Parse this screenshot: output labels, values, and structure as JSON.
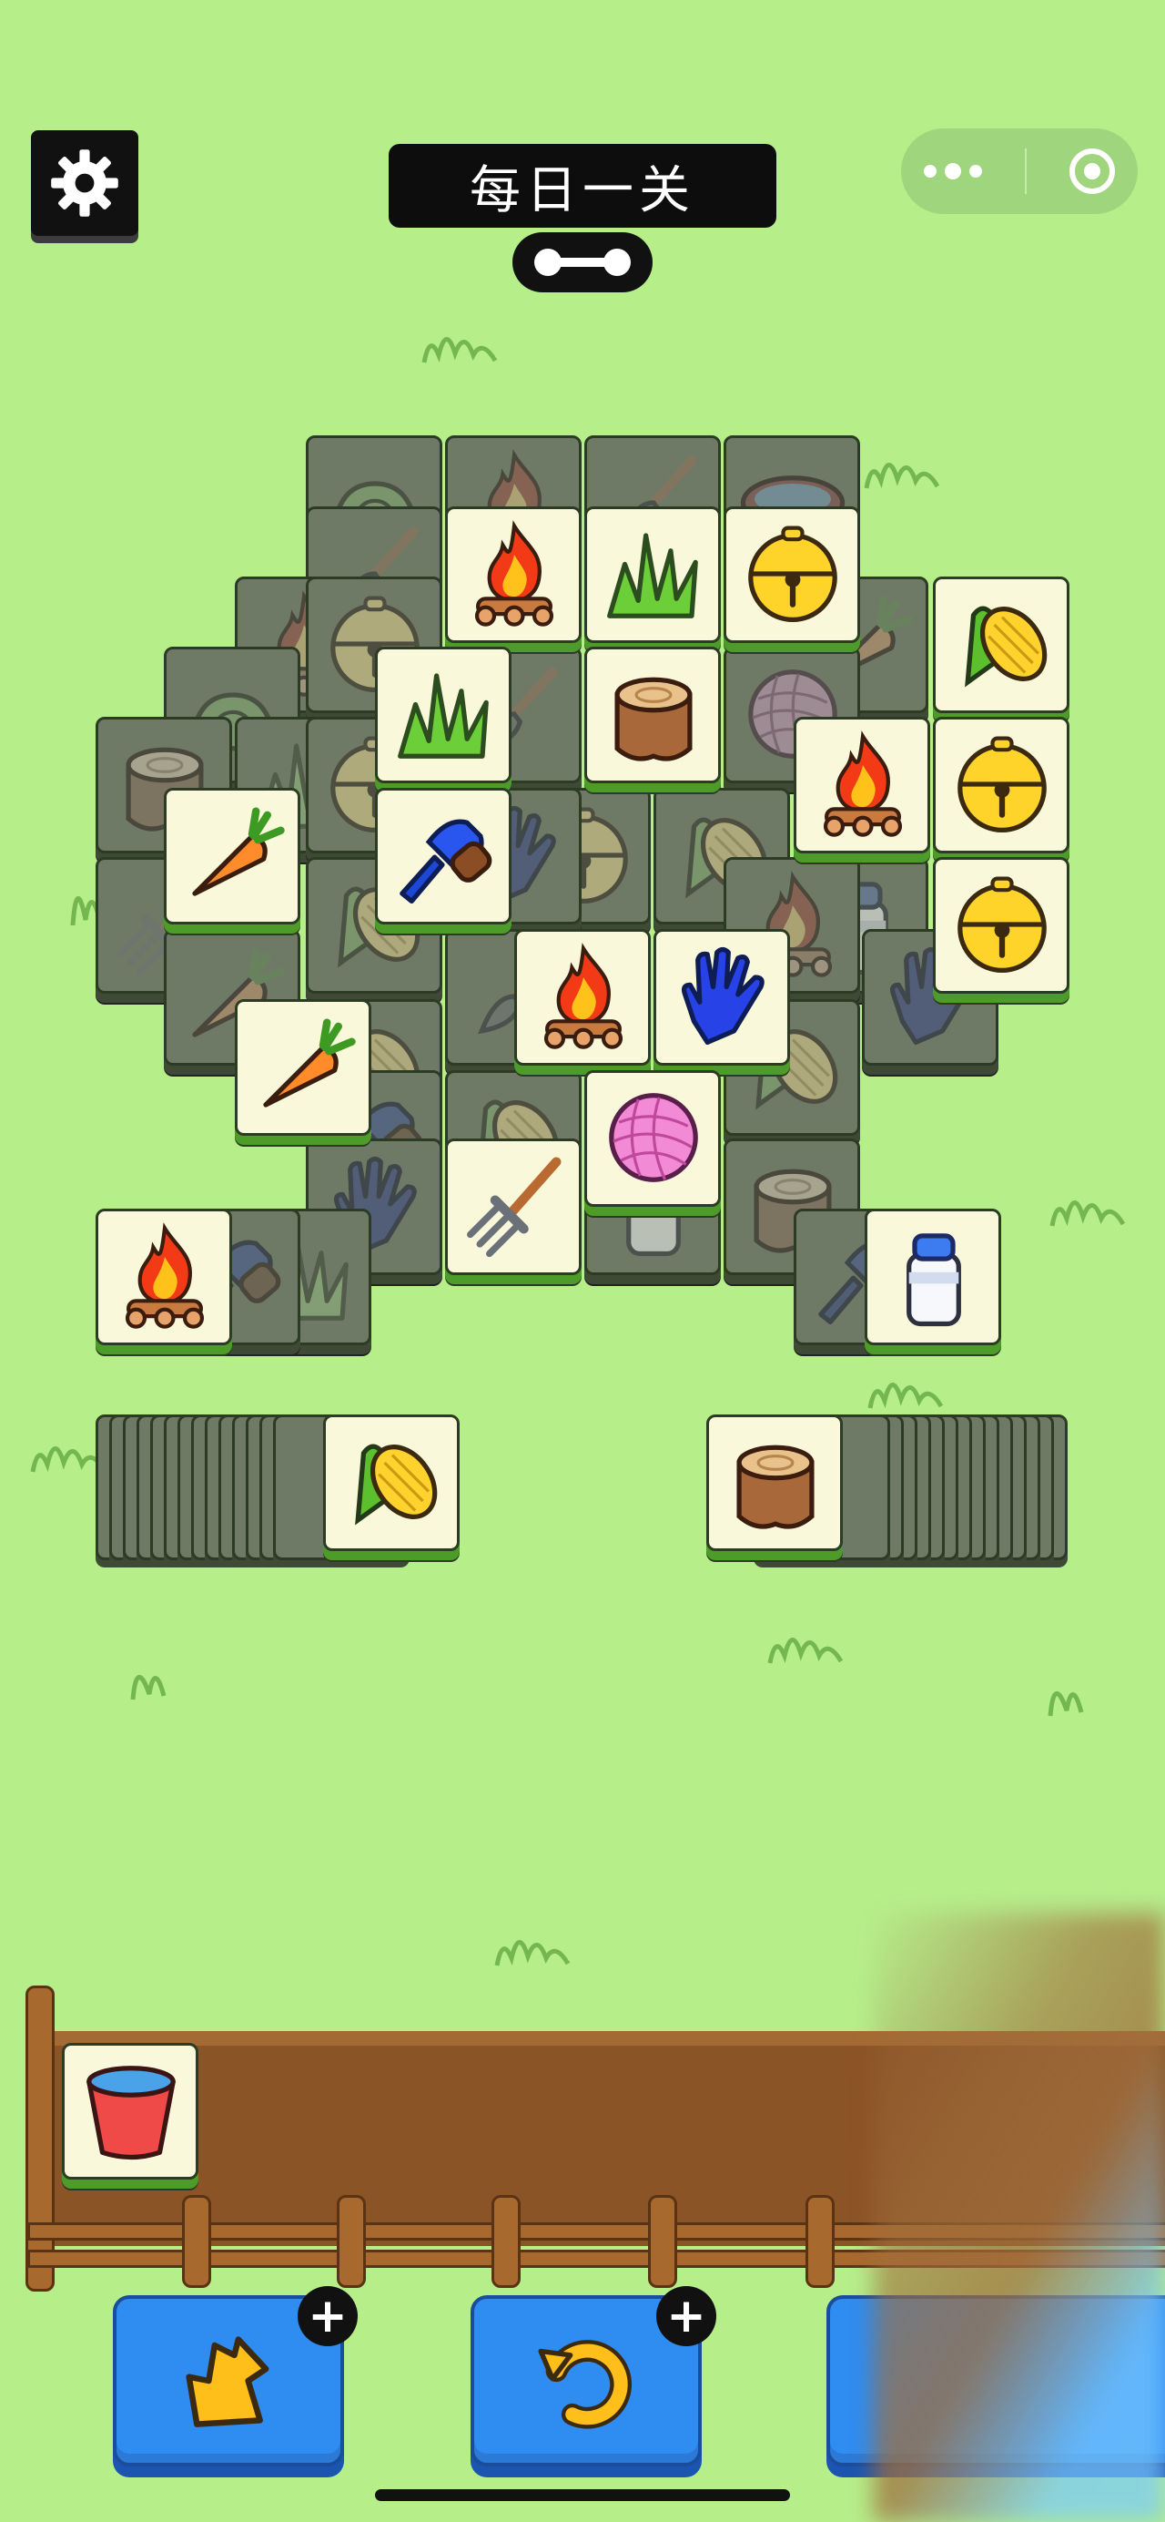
{
  "header": {
    "title": "每日一关",
    "settings_icon": "gear-icon",
    "progress_icon": "progress-link-icon",
    "capsule_icons": [
      "more-dots-icon",
      "close-target-icon"
    ]
  },
  "board": {
    "visible_top_tiles": [
      "campfire",
      "grass",
      "bell",
      "stump",
      "corn",
      "carrot",
      "brush",
      "campfire",
      "bell",
      "bell",
      "campfire",
      "glove",
      "carrot",
      "yarn",
      "rake",
      "campfire",
      "milk-bottle"
    ],
    "covered_tiles": [
      "lettuce",
      "campfire",
      "shovel",
      "water-pan",
      "shovel",
      "bell",
      "campfire",
      "lettuce",
      "carrot",
      "shovel",
      "yarn",
      "stump",
      "corn",
      "rake",
      "glove",
      "corn",
      "milk-bottle",
      "campfire",
      "glove",
      "bell",
      "corn",
      "brush",
      "glove",
      "stump",
      "glove",
      "grass",
      "brush"
    ]
  },
  "stacks": {
    "left_top_tile": "corn",
    "right_top_tile": "stump"
  },
  "tray": {
    "slots": [
      "bucket"
    ]
  },
  "tools": [
    {
      "name": "shuffle-tool",
      "icon": "shuffle-arrow-icon",
      "badge": "+"
    },
    {
      "name": "undo-tool",
      "icon": "undo-icon",
      "badge": "+"
    },
    {
      "name": "third-tool",
      "icon": "",
      "badge": ""
    }
  ],
  "colors": {
    "background": "#b6ee8a",
    "tile_face": "#f9f8da",
    "tile_shadow": "#4d9b29",
    "covered_tile": "#6f7a66",
    "button_blue": "#2f8cf0",
    "tray_wood": "#8b5426"
  }
}
